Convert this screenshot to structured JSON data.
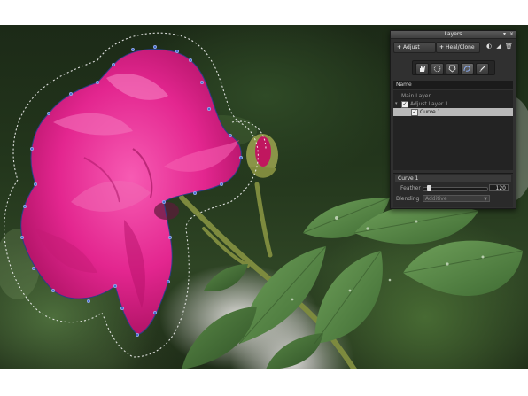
{
  "panel": {
    "title": "Layers",
    "adjust_label": "Adjust",
    "heal_clone_label": "Heal/Clone",
    "list_header": "Name",
    "layers": [
      {
        "name": "Main Layer",
        "checked": false,
        "selected": false
      },
      {
        "name": "Adjust Layer 1",
        "checked": true,
        "selected": false,
        "expanded": true
      },
      {
        "name": "Curve 1",
        "checked": true,
        "selected": true
      }
    ],
    "properties": {
      "section_title": "Curve 1",
      "feather_label": "Feather",
      "feather_value": "120",
      "blending_label": "Blending",
      "blending_value": "Additive"
    },
    "tools": [
      "hand-tool",
      "circle-select-tool",
      "polygon-select-tool",
      "freehand-curve-tool",
      "brush-tool"
    ]
  },
  "colors": {
    "panel_bg": "#303030",
    "selection_row": "#b9b9b9",
    "curve_points": "#4a6fd0",
    "rose_pink": "#e3268f"
  }
}
